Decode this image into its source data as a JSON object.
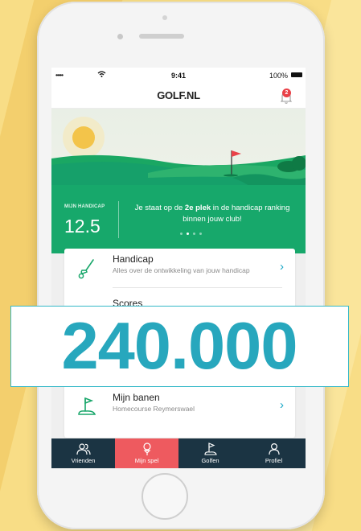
{
  "status_bar": {
    "signal": "•••••",
    "time": "9:41",
    "battery": "100%"
  },
  "app": {
    "title": "GOLF.NL",
    "notification_count": "2"
  },
  "hero": {
    "handicap_label": "MIJN HANDICAP",
    "handicap_value": "12.5",
    "ranking_prefix": "Je staat op de ",
    "ranking_highlight": "2e plek",
    "ranking_suffix": " in de handicap ranking binnen jouw club!"
  },
  "menu": [
    {
      "title": "Handicap",
      "subtitle": "Alles over de ontwikkeling van jouw handicap",
      "icon": "golf-club-icon"
    },
    {
      "title": "Scores",
      "subtitle": "",
      "icon": "scorecard-icon"
    },
    {
      "title": "Mijn banen",
      "subtitle": "Homecourse Reymerswael",
      "icon": "flag-green-icon"
    }
  ],
  "tabs": [
    {
      "label": "Vrienden",
      "icon": "friends-icon"
    },
    {
      "label": "Mijn spel",
      "icon": "golf-ball-tee-icon"
    },
    {
      "label": "Golfen",
      "icon": "flag-icon"
    },
    {
      "label": "Profiel",
      "icon": "profile-icon"
    }
  ],
  "overlay_number": "240.000",
  "colors": {
    "accent": "#27a7bd",
    "green": "#18a66a",
    "tabbar": "#1b3443",
    "active_tab": "#ee5a5f",
    "background": "#f8dd86"
  }
}
